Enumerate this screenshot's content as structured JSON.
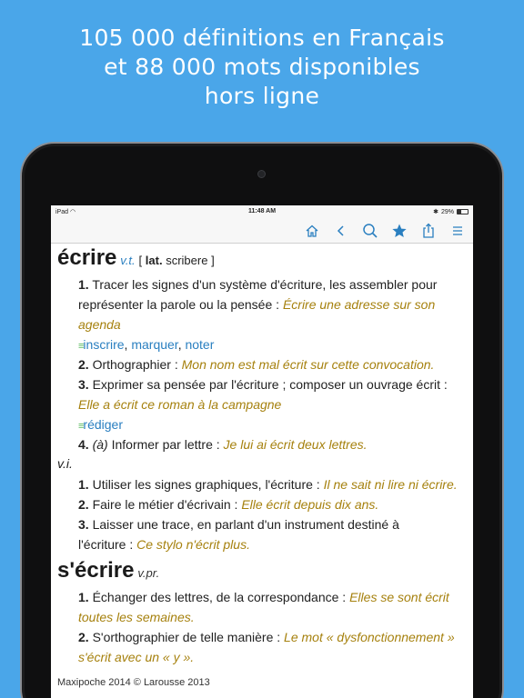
{
  "headline": {
    "line1": "105 000 définitions en Français",
    "line2": "et 88 000 mots disponibles",
    "line3": "hors ligne"
  },
  "statusbar": {
    "device": "iPad",
    "time": "11:48 AM",
    "battery": "29%"
  },
  "toolbar": {
    "icons": [
      "home-icon",
      "back-icon",
      "search-icon",
      "star-icon",
      "share-icon",
      "menu-icon"
    ],
    "accent": "#2a7fc0"
  },
  "entry1": {
    "headword": "écrire",
    "gram": "v.t.",
    "etym_open": "[",
    "etym_lang": "lat.",
    "etym_word": "scribere",
    "etym_close": "]",
    "senses": [
      {
        "num": "1.",
        "text1": "Tracer les signes d'un système d'écriture, les assembler pour",
        "text2": "représenter la parole ou la pensée : ",
        "ex2": "Écrire une adresse sur son",
        "ex3": "agenda",
        "synonyms": [
          "inscrire",
          "marquer",
          "noter"
        ]
      },
      {
        "num": "2.",
        "text": "Orthographier : ",
        "ex": "Mon nom est mal écrit sur cette convocation."
      },
      {
        "num": "3.",
        "text1": "Exprimer sa pensée par l'écriture ; composer un ouvrage écrit :",
        "ex2": "Elle a écrit ce roman à la campagne",
        "synonyms": [
          "rédiger"
        ]
      },
      {
        "num": "4.",
        "text_it": "(à)",
        "text": " Informer par lettre : ",
        "ex": "Je lui ai écrit deux lettres."
      }
    ],
    "vi_label": "v.i.",
    "vi_senses": [
      {
        "num": "1.",
        "text": "Utiliser les signes graphiques, l'écriture : ",
        "ex": "Il ne sait ni lire ni écrire."
      },
      {
        "num": "2.",
        "text": "Faire le métier d'écrivain : ",
        "ex": "Elle écrit depuis dix ans."
      },
      {
        "num": "3.",
        "text1": "Laisser une trace, en parlant d'un instrument destiné à",
        "text2": "l'écriture : ",
        "ex2": "Ce stylo n'écrit plus."
      }
    ]
  },
  "entry2": {
    "headword": "s'écrire",
    "gram": "v.pr.",
    "senses": [
      {
        "num": "1.",
        "text1": "Échanger des lettres, de la correspondance : ",
        "ex1": "Elles se sont écrit",
        "ex2": "toutes les semaines."
      },
      {
        "num": "2.",
        "text1": "S'orthographier de telle manière : ",
        "ex1": "Le mot « dysfonctionnement »",
        "ex2": "s'écrit avec un « y »."
      }
    ]
  },
  "footer": "Maxipoche 2014 © Larousse 2013",
  "colors": {
    "background": "#4aa6e9",
    "example": "#a6810e",
    "link": "#2a7fc0",
    "synonym_marker": "#55b85a"
  }
}
